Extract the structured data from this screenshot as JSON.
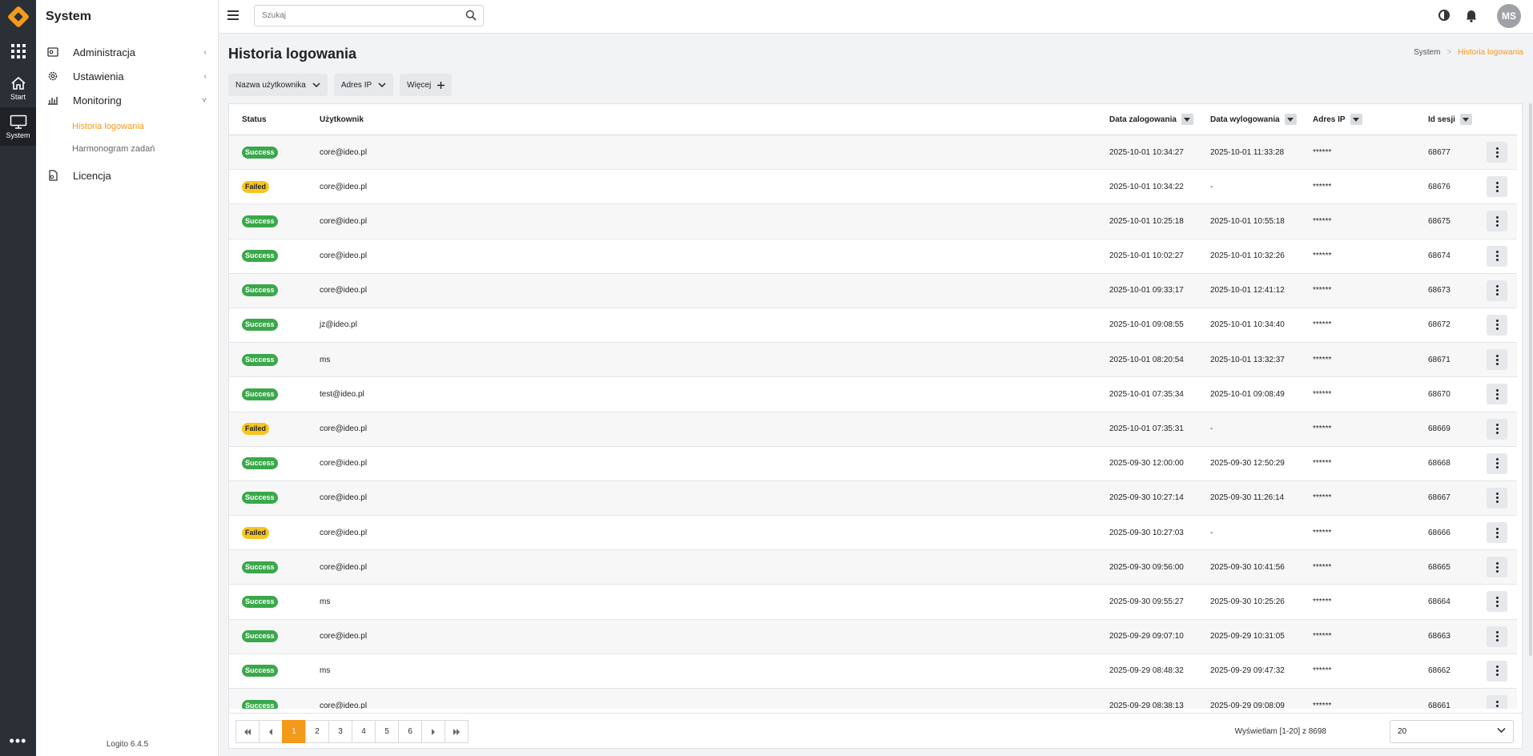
{
  "rail": {
    "items": [
      {
        "label": "Start",
        "icon": "home-icon"
      },
      {
        "label": "System",
        "icon": "monitor-icon"
      }
    ],
    "more": "•••"
  },
  "sidenav": {
    "title": "System",
    "items": [
      {
        "label": "Administracja",
        "icon": "admin-icon"
      },
      {
        "label": "Ustawienia",
        "icon": "gear-icon"
      },
      {
        "label": "Monitoring",
        "icon": "chart-icon"
      },
      {
        "label": "Licencja",
        "icon": "license-icon"
      }
    ],
    "sub": [
      {
        "label": "Historia logowania"
      },
      {
        "label": "Harmonogram zadań"
      }
    ],
    "version": "Logito 6.4.5"
  },
  "topbar": {
    "search_placeholder": "Szukaj",
    "avatar": "MS"
  },
  "page": {
    "title": "Historia logowania",
    "breadcrumb": [
      "System",
      "Historia logowania"
    ]
  },
  "filters": [
    "Nazwa użytkownika",
    "Adres IP",
    "Więcej"
  ],
  "table": {
    "columns": [
      "Status",
      "Użytkownik",
      "Data zalogowania",
      "Data wylogowania",
      "Adres IP",
      "Id sesji"
    ],
    "rows": [
      {
        "status": "Success",
        "user": "core@ideo.pl",
        "login": "2025-10-01 10:34:27",
        "logout": "2025-10-01 11:33:28",
        "ip": "******",
        "id": "68677"
      },
      {
        "status": "Failed",
        "user": "core@ideo.pl",
        "login": "2025-10-01 10:34:22",
        "logout": "-",
        "ip": "******",
        "id": "68676"
      },
      {
        "status": "Success",
        "user": "core@ideo.pl",
        "login": "2025-10-01 10:25:18",
        "logout": "2025-10-01 10:55:18",
        "ip": "******",
        "id": "68675"
      },
      {
        "status": "Success",
        "user": "core@ideo.pl",
        "login": "2025-10-01 10:02:27",
        "logout": "2025-10-01 10:32:26",
        "ip": "******",
        "id": "68674"
      },
      {
        "status": "Success",
        "user": "core@ideo.pl",
        "login": "2025-10-01 09:33:17",
        "logout": "2025-10-01 12:41:12",
        "ip": "******",
        "id": "68673"
      },
      {
        "status": "Success",
        "user": "jz@ideo.pl",
        "login": "2025-10-01 09:08:55",
        "logout": "2025-10-01 10:34:40",
        "ip": "******",
        "id": "68672"
      },
      {
        "status": "Success",
        "user": "ms",
        "login": "2025-10-01 08:20:54",
        "logout": "2025-10-01 13:32:37",
        "ip": "******",
        "id": "68671"
      },
      {
        "status": "Success",
        "user": "test@ideo.pl",
        "login": "2025-10-01 07:35:34",
        "logout": "2025-10-01 09:08:49",
        "ip": "******",
        "id": "68670"
      },
      {
        "status": "Failed",
        "user": "core@ideo.pl",
        "login": "2025-10-01 07:35:31",
        "logout": "-",
        "ip": "******",
        "id": "68669"
      },
      {
        "status": "Success",
        "user": "core@ideo.pl",
        "login": "2025-09-30 12:00:00",
        "logout": "2025-09-30 12:50:29",
        "ip": "******",
        "id": "68668"
      },
      {
        "status": "Success",
        "user": "core@ideo.pl",
        "login": "2025-09-30 10:27:14",
        "logout": "2025-09-30 11:26:14",
        "ip": "******",
        "id": "68667"
      },
      {
        "status": "Failed",
        "user": "core@ideo.pl",
        "login": "2025-09-30 10:27:03",
        "logout": "-",
        "ip": "******",
        "id": "68666"
      },
      {
        "status": "Success",
        "user": "core@ideo.pl",
        "login": "2025-09-30 09:56:00",
        "logout": "2025-09-30 10:41:56",
        "ip": "******",
        "id": "68665"
      },
      {
        "status": "Success",
        "user": "ms",
        "login": "2025-09-30 09:55:27",
        "logout": "2025-09-30 10:25:26",
        "ip": "******",
        "id": "68664"
      },
      {
        "status": "Success",
        "user": "core@ideo.pl",
        "login": "2025-09-29 09:07:10",
        "logout": "2025-09-29 10:31:05",
        "ip": "******",
        "id": "68663"
      },
      {
        "status": "Success",
        "user": "ms",
        "login": "2025-09-29 08:48:32",
        "logout": "2025-09-29 09:47:32",
        "ip": "******",
        "id": "68662"
      },
      {
        "status": "Success",
        "user": "core@ideo.pl",
        "login": "2025-09-29 08:38:13",
        "logout": "2025-09-29 09:08:09",
        "ip": "******",
        "id": "68661"
      }
    ]
  },
  "pagination": {
    "pages": [
      "1",
      "2",
      "3",
      "4",
      "5",
      "6"
    ],
    "current": "1",
    "info": "Wyświetlam [1-20] z 8698",
    "page_size": "20"
  },
  "colors": {
    "accent": "#f39a1b",
    "success": "#3aa84a",
    "failed": "#f7c51e",
    "rail": "#2b2f36"
  }
}
